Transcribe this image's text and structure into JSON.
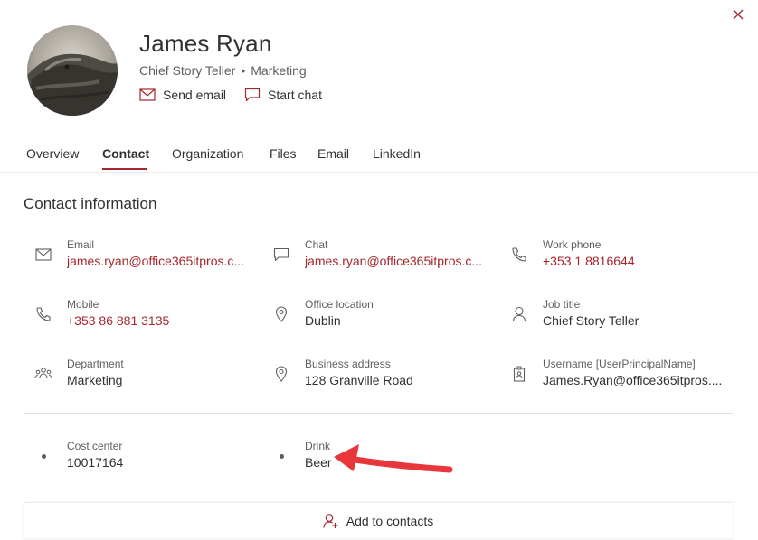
{
  "profile": {
    "name": "James Ryan",
    "job_title": "Chief Story Teller",
    "separator": "•",
    "department": "Marketing",
    "avatar_icon": "avatar-photo",
    "actions": {
      "send_email": "Send email",
      "start_chat": "Start chat"
    }
  },
  "tabs": [
    {
      "label": "Overview",
      "active": false
    },
    {
      "label": "Contact",
      "active": true
    },
    {
      "label": "Organization",
      "active": false
    },
    {
      "label": "Files",
      "active": false
    },
    {
      "label": "Email",
      "active": false
    },
    {
      "label": "LinkedIn",
      "active": false
    }
  ],
  "contact": {
    "section_title": "Contact information",
    "fields": {
      "email": {
        "label": "Email",
        "value": "james.ryan@office365itpros.c...",
        "icon": "mail-icon"
      },
      "chat": {
        "label": "Chat",
        "value": "james.ryan@office365itpros.c...",
        "icon": "chat-icon"
      },
      "work_phone": {
        "label": "Work phone",
        "value": "+353 1 8816644",
        "icon": "phone-icon"
      },
      "mobile": {
        "label": "Mobile",
        "value": "+353 86 881 3135",
        "icon": "phone-icon"
      },
      "office_location": {
        "label": "Office location",
        "value": "Dublin",
        "icon": "location-icon"
      },
      "job_title": {
        "label": "Job title",
        "value": "Chief Story Teller",
        "icon": "person-icon"
      },
      "department": {
        "label": "Department",
        "value": "Marketing",
        "icon": "people-icon"
      },
      "business_address": {
        "label": "Business address",
        "value": "128 Granville Road",
        "icon": "location-icon"
      },
      "username": {
        "label": "Username [UserPrincipalName]",
        "value": "James.Ryan@office365itpros....",
        "icon": "badge-icon"
      },
      "cost_center": {
        "label": "Cost center",
        "value": "10017164",
        "icon": "bullet-icon"
      },
      "drink": {
        "label": "Drink",
        "value": "Beer",
        "icon": "bullet-icon"
      }
    }
  },
  "footer": {
    "add_to_contacts": "Add to contacts"
  },
  "colors": {
    "accent": "#a4262c",
    "text": "#323130",
    "secondary_text": "#605e5c",
    "arrow": "#e8373a"
  }
}
